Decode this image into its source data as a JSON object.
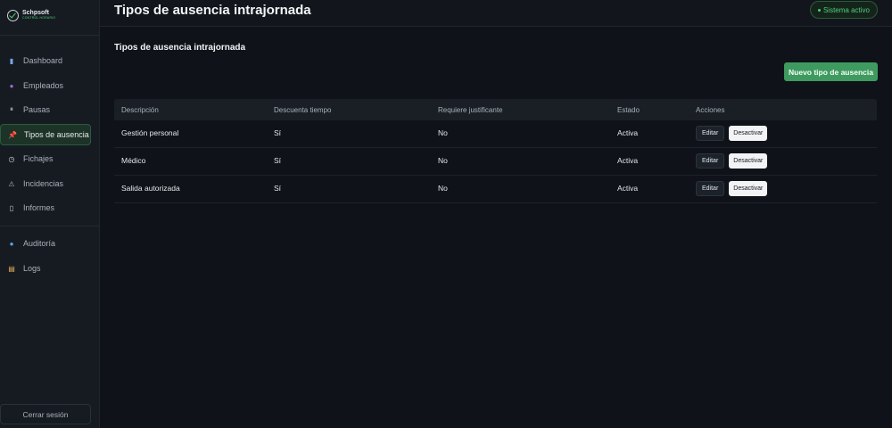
{
  "brand": {
    "name": "Schpsoft",
    "sub": "CONTROL HORARIO"
  },
  "sidebar": {
    "items": [
      {
        "label": "Dashboard",
        "icon": "chart-icon",
        "glyph": "▮",
        "color": "#7aa7e8"
      },
      {
        "label": "Empleados",
        "icon": "person-icon",
        "glyph": "●",
        "color": "#9b6bd6"
      },
      {
        "label": "Pausas",
        "icon": "pause-icon",
        "glyph": "⏸",
        "color": "#aab1ba"
      },
      {
        "label": "Tipos de ausencia",
        "icon": "pin-icon",
        "glyph": "📌",
        "color": "#e05563"
      },
      {
        "label": "Fichajes",
        "icon": "clock-icon",
        "glyph": "◷",
        "color": "#cfd4da"
      },
      {
        "label": "Incidencias",
        "icon": "warning-icon",
        "glyph": "⚠",
        "color": "#aab1ba"
      },
      {
        "label": "Informes",
        "icon": "document-icon",
        "glyph": "▯",
        "color": "#cfd4da"
      },
      {
        "label": "Auditoría",
        "icon": "magnifier-icon",
        "glyph": "●",
        "color": "#5aa8e8"
      },
      {
        "label": "Logs",
        "icon": "scroll-icon",
        "glyph": "▤",
        "color": "#e8b25a"
      }
    ],
    "logout_label": "Cerrar sesión"
  },
  "header": {
    "title": "Tipos de ausencia intrajornada",
    "status": "Sistema activo"
  },
  "main": {
    "section_title": "Tipos de ausencia intrajornada",
    "new_button": "Nuevo tipo de ausencia",
    "columns": [
      "Descripción",
      "Descuenta tiempo",
      "Requiere justificante",
      "Estado",
      "Acciones"
    ],
    "rows": [
      {
        "descripcion": "Gestión personal",
        "descuenta": "Sí",
        "justificante": "No",
        "estado": "Activa",
        "edit": "Editar",
        "deact": "Desactivar"
      },
      {
        "descripcion": "Médico",
        "descuenta": "Sí",
        "justificante": "No",
        "estado": "Activa",
        "edit": "Editar",
        "deact": "Desactivar"
      },
      {
        "descripcion": "Salida autorizada",
        "descuenta": "Sí",
        "justificante": "No",
        "estado": "Activa",
        "edit": "Editar",
        "deact": "Desactivar"
      }
    ]
  },
  "colors": {
    "accent": "#3f9a5f",
    "active_text": "#4ad07a"
  }
}
